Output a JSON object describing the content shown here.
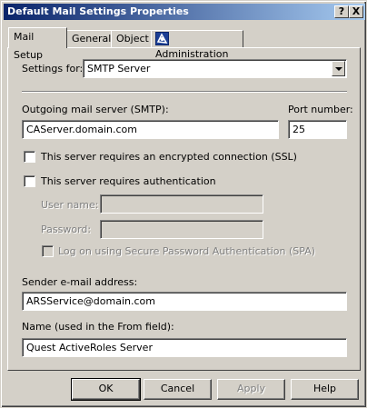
{
  "window": {
    "title": "Default Mail Settings Properties",
    "help_button": "?",
    "close_button": "X"
  },
  "tabs": [
    {
      "label": "Mail Setup",
      "active": true
    },
    {
      "label": "General",
      "active": false
    },
    {
      "label": "Object",
      "active": false
    },
    {
      "label": "Administration",
      "active": false,
      "icon": "administration-icon"
    }
  ],
  "form": {
    "settings_for_label": "Settings for:",
    "settings_for_value": "SMTP Server",
    "outgoing_label": "Outgoing mail server (SMTP):",
    "outgoing_value": "CAServer.domain.com",
    "port_label": "Port number:",
    "port_value": "25",
    "ssl_label": "This server requires an encrypted connection (SSL)",
    "auth_label": "This server requires authentication",
    "username_label": "User name:",
    "username_value": "",
    "password_label": "Password:",
    "password_value": "",
    "spa_label": "Log on using Secure Password Authentication (SPA)",
    "sender_label": "Sender e-mail address:",
    "sender_value": "ARSService@domain.com",
    "name_label": "Name (used in the From field):",
    "name_value": "Quest ActiveRoles Server"
  },
  "buttons": {
    "ok": "OK",
    "cancel": "Cancel",
    "apply": "Apply",
    "help": "Help"
  },
  "colors": {
    "title_start": "#0a246a",
    "title_end": "#a6caf0",
    "face": "#d4d0c8"
  }
}
